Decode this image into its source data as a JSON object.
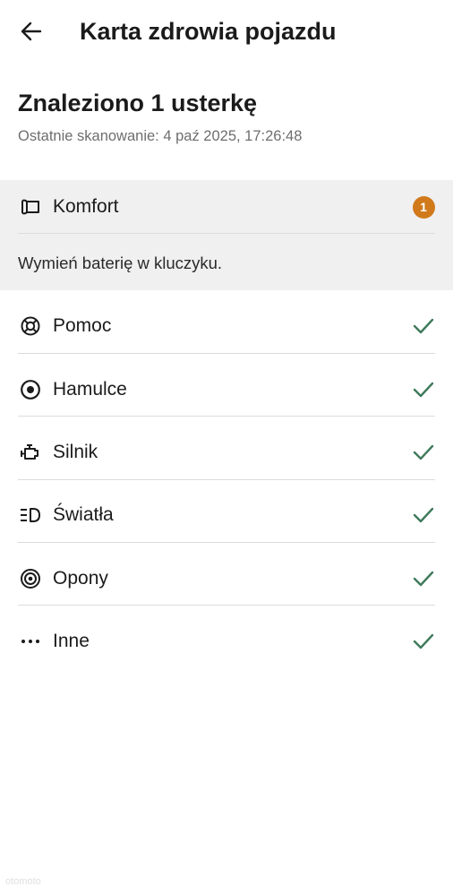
{
  "header": {
    "title": "Karta zdrowia pojazdu",
    "back_icon": "arrow-left-icon"
  },
  "summary": {
    "title": "Znaleziono 1 usterkę",
    "last_scan": "Ostatnie skanowanie: 4 paź 2025, 17:26:48"
  },
  "fault_category": {
    "label": "Komfort",
    "icon": "comfort-seat-icon",
    "badge_count": "1",
    "badge_color": "#d17a1b",
    "message": "Wymień baterię w kluczyku."
  },
  "categories": [
    {
      "label": "Pomoc",
      "icon": "lifebuoy-icon",
      "status": "ok"
    },
    {
      "label": "Hamulce",
      "icon": "brake-icon",
      "status": "ok"
    },
    {
      "label": "Silnik",
      "icon": "engine-icon",
      "status": "ok"
    },
    {
      "label": "Światła",
      "icon": "headlight-icon",
      "status": "ok"
    },
    {
      "label": "Opony",
      "icon": "tire-icon",
      "status": "ok"
    },
    {
      "label": "Inne",
      "icon": "more-dots-icon",
      "status": "ok"
    }
  ],
  "colors": {
    "check": "#3f7a5b",
    "fault_background": "#f0f0f0"
  },
  "watermark": "otomoto"
}
